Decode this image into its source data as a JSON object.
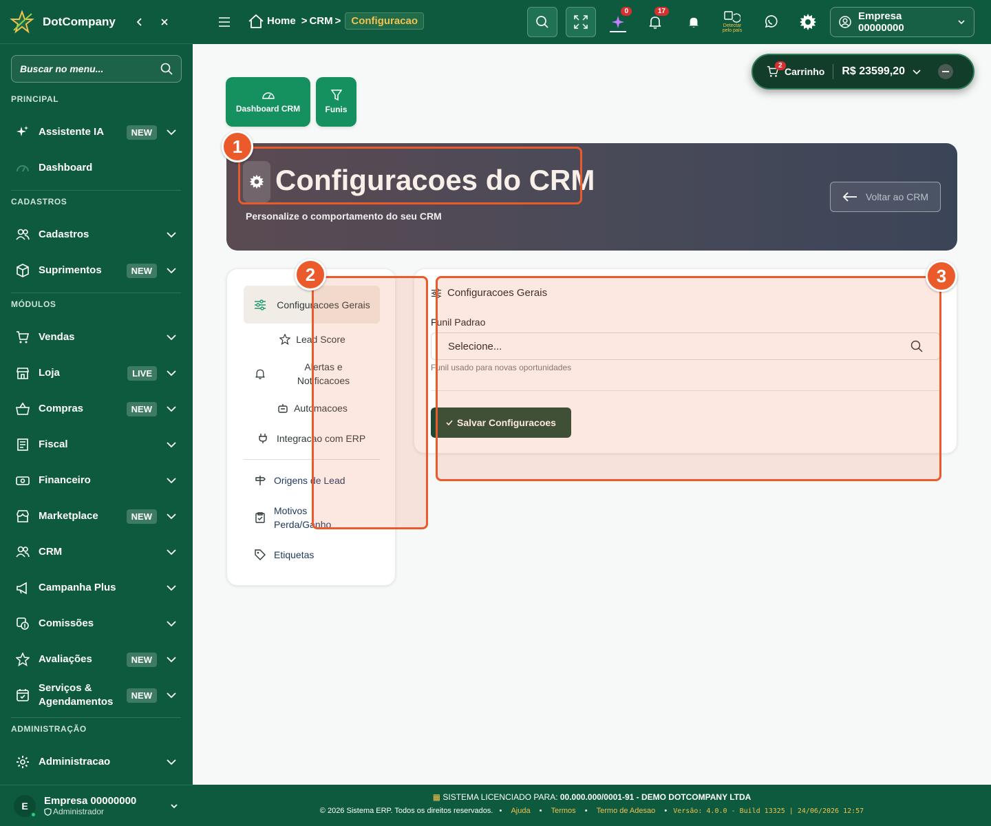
{
  "app": {
    "brand": "DotCompany"
  },
  "sidebar": {
    "search_placeholder": "Buscar no menu...",
    "sections": {
      "principal": "PRINCIPAL",
      "cadastros": "CADASTROS",
      "modulos": "MÓDULOS",
      "administracao": "ADMINISTRAÇÃO"
    },
    "items": [
      {
        "label": "Assistente IA",
        "badge": "NEW"
      },
      {
        "label": "Dashboard",
        "badge": ""
      },
      {
        "label": "Cadastros",
        "badge": ""
      },
      {
        "label": "Suprimentos",
        "badge": "NEW"
      },
      {
        "label": "Vendas",
        "badge": ""
      },
      {
        "label": "Loja",
        "badge": "LIVE"
      },
      {
        "label": "Compras",
        "badge": "NEW"
      },
      {
        "label": "Fiscal",
        "badge": ""
      },
      {
        "label": "Financeiro",
        "badge": ""
      },
      {
        "label": "Marketplace",
        "badge": "NEW"
      },
      {
        "label": "CRM",
        "badge": ""
      },
      {
        "label": "Campanha Plus",
        "badge": ""
      },
      {
        "label": "Comissões",
        "badge": ""
      },
      {
        "label": "Avaliações",
        "badge": "NEW"
      },
      {
        "label": "Serviços & Agendamentos",
        "badge": "NEW"
      },
      {
        "label": "Administracao",
        "badge": ""
      }
    ],
    "user": {
      "initial": "E",
      "name": "Empresa 00000000",
      "role": "Administrador"
    }
  },
  "topbar": {
    "breadcrumb": {
      "home": "Home",
      "crm": "CRM",
      "current": "Configuracao"
    },
    "ai_count": "0",
    "notif_count": "17",
    "country_label": "Detectar pelo país",
    "company": "Empresa 00000000"
  },
  "cart": {
    "label": "Carrinho",
    "count": "2",
    "total": "R$ 23599,20"
  },
  "quick": {
    "dashboard": "Dashboard CRM",
    "funis": "Funis"
  },
  "hero": {
    "title": "Configuracoes do CRM",
    "subtitle": "Personalize o comportamento do seu CRM",
    "back": "Voltar ao CRM"
  },
  "tabs": [
    {
      "label": "Configuracoes Gerais"
    },
    {
      "label": "Lead Score"
    },
    {
      "label": "Alertas e Notificacoes"
    },
    {
      "label": "Automacoes"
    },
    {
      "label": "Integracao com ERP"
    },
    {
      "label": "Origens de Lead"
    },
    {
      "label": "Motivos Perda/Ganho"
    },
    {
      "label": "Etiquetas"
    }
  ],
  "settings": {
    "header": "Configuracoes Gerais",
    "field_label": "Funil Padrao",
    "select_value": "Selecione...",
    "help": "Funil usado para novas oportunidades",
    "save": "Salvar Configuracoes"
  },
  "annotations": [
    "1",
    "2",
    "3"
  ],
  "footer": {
    "license_prefix": "SISTEMA LICENCIADO PARA:",
    "license_value": "00.000.000/0001-91 - DEMO DOTCOMPANY LTDA",
    "copyright": "© 2026 Sistema ERP. Todos os direitos reservados.",
    "links": [
      "Ajuda",
      "Termos",
      "Termo de Adesao"
    ],
    "version": "Versão: 4.0.0 - Build 13325 | 24/06/2026 12:57"
  },
  "colors": {
    "primary": "#0e5a3e",
    "accent": "#f2c14e",
    "annotation": "#ea5a2b",
    "badge": "#d63031"
  }
}
